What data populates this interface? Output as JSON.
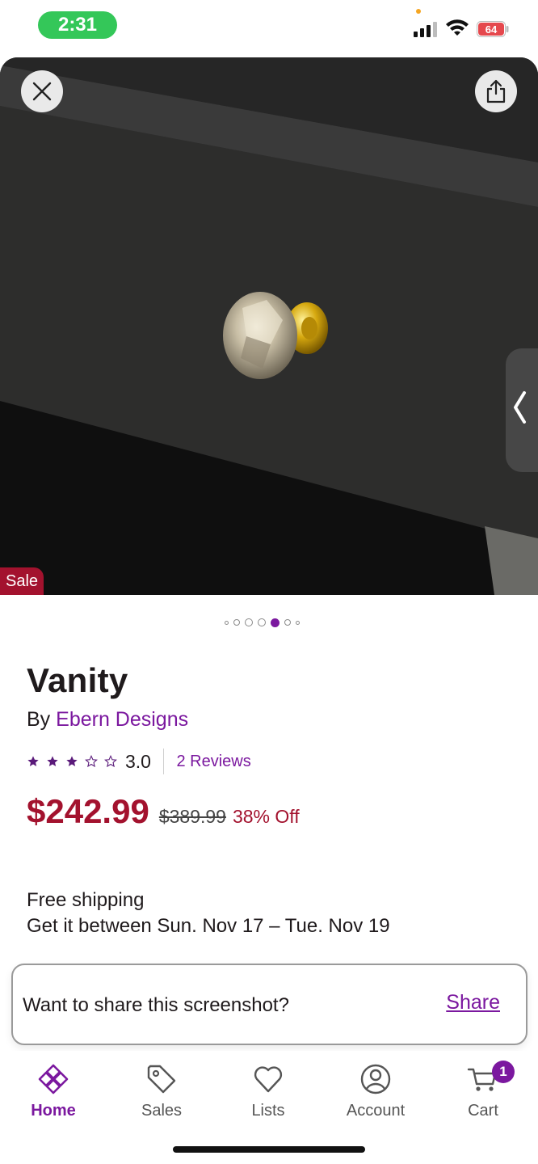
{
  "status_bar": {
    "time": "2:31",
    "battery": "64"
  },
  "hero": {
    "sale_badge": "Sale",
    "carousel": {
      "total": 7,
      "active_index": 4
    }
  },
  "product": {
    "title": "Vanity",
    "by_prefix": "By",
    "brand": "Ebern Designs",
    "rating": {
      "value": 3.0,
      "value_label": "3.0",
      "max": 5
    },
    "reviews_label": "2 Reviews",
    "price": "$242.99",
    "original_price": "$389.99",
    "discount": "38% Off"
  },
  "shipping": {
    "line1": "Free shipping",
    "line2": "Get it between Sun. Nov 17 – Tue. Nov 19"
  },
  "toast": {
    "message": "Want to share this screenshot?",
    "action": "Share"
  },
  "bottom_nav": {
    "items": [
      {
        "label": "Home",
        "icon": "home-icon",
        "active": true
      },
      {
        "label": "Sales",
        "icon": "tag-icon",
        "active": false
      },
      {
        "label": "Lists",
        "icon": "heart-icon",
        "active": false
      },
      {
        "label": "Account",
        "icon": "account-icon",
        "active": false
      },
      {
        "label": "Cart",
        "icon": "cart-icon",
        "active": false
      }
    ],
    "cart_count": "1"
  },
  "colors": {
    "brand_purple": "#7b189f",
    "sale_red": "#a3122e",
    "status_green": "#34c759"
  }
}
